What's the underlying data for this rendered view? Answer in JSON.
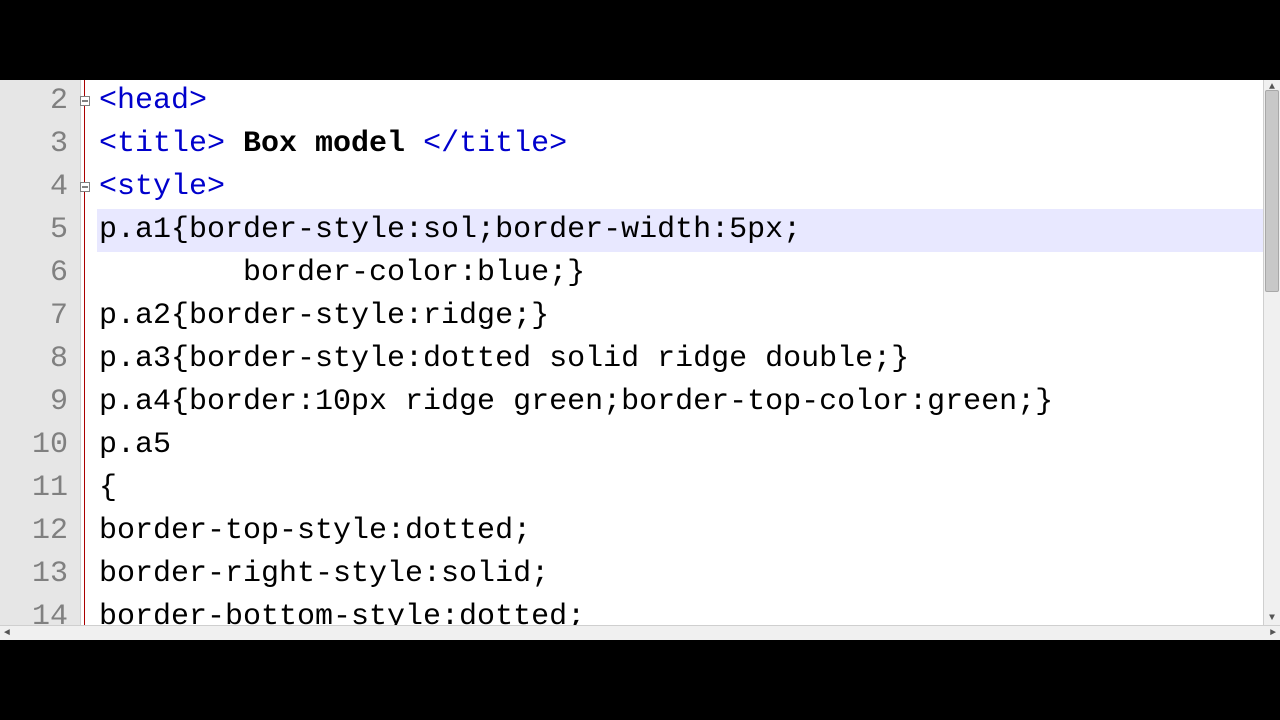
{
  "editor": {
    "first_visible_line": 2,
    "current_line_index": 3,
    "lines": [
      {
        "num": "2",
        "segments": [
          {
            "cls": "tok-tag",
            "t": "<head>"
          }
        ],
        "fold": true
      },
      {
        "num": "3",
        "segments": [
          {
            "cls": "tok-tag",
            "t": "<title>"
          },
          {
            "cls": "tok-title",
            "t": " Box model "
          },
          {
            "cls": "tok-tag",
            "t": "</title>"
          }
        ]
      },
      {
        "num": "4",
        "segments": [
          {
            "cls": "tok-tag",
            "t": "<style>"
          }
        ],
        "fold": true
      },
      {
        "num": "5",
        "segments": [
          {
            "cls": "tok-plain",
            "t": "p.a1{border-style:sol;border-width:5px;"
          }
        ],
        "current": true
      },
      {
        "num": "6",
        "segments": [
          {
            "cls": "tok-plain",
            "t": "        border-color:blue;}"
          }
        ]
      },
      {
        "num": "7",
        "segments": [
          {
            "cls": "tok-plain",
            "t": "p.a2{border-style:ridge;}"
          }
        ]
      },
      {
        "num": "8",
        "segments": [
          {
            "cls": "tok-plain",
            "t": "p.a3{border-style:dotted solid ridge double;}"
          }
        ]
      },
      {
        "num": "9",
        "segments": [
          {
            "cls": "tok-plain",
            "t": "p.a4{border:10px ridge green;border-top-color:green;}"
          }
        ]
      },
      {
        "num": "10",
        "segments": [
          {
            "cls": "tok-plain",
            "t": "p.a5"
          }
        ]
      },
      {
        "num": "11",
        "segments": [
          {
            "cls": "tok-plain",
            "t": "{"
          }
        ]
      },
      {
        "num": "12",
        "segments": [
          {
            "cls": "tok-plain",
            "t": "border-top-style:dotted;"
          }
        ]
      },
      {
        "num": "13",
        "segments": [
          {
            "cls": "tok-plain",
            "t": "border-right-style:solid;"
          }
        ]
      },
      {
        "num": "14",
        "segments": [
          {
            "cls": "tok-plain",
            "t": "border-bottom-style:dotted;"
          }
        ]
      }
    ]
  },
  "scroll": {
    "up_glyph": "▲",
    "down_glyph": "▼",
    "left_glyph": "◄",
    "right_glyph": "►"
  }
}
